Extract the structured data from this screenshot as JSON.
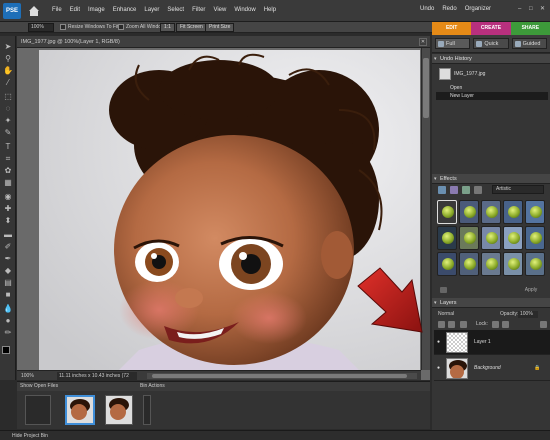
{
  "app": {
    "logo": "PSE",
    "title": "IMG_1977.jpg @ 100%(Layer 1, RGB/8)"
  },
  "menu": [
    "File",
    "Edit",
    "Image",
    "Enhance",
    "Layer",
    "Select",
    "Filter",
    "View",
    "Window",
    "Help"
  ],
  "top_right": {
    "undo": "Undo",
    "redo": "Redo",
    "organizer": "Organizer"
  },
  "options_bar": {
    "zoom": "100%",
    "resize_windows": "Resize Windows To Fit",
    "zoom_all": "Zoom All Windows",
    "one_to_one": "1:1",
    "fit_screen": "Fit Screen",
    "print_size": "Print Size"
  },
  "modes": {
    "edit": "EDIT",
    "create": "CREATE",
    "share": "SHARE"
  },
  "subtabs": {
    "full": "Full",
    "quick": "Quick",
    "guided": "Guided"
  },
  "doc_status": {
    "zoom": "100%",
    "dimensions": "11.11 inches x 10.43 inches (72 ppi)"
  },
  "undo_history": {
    "title": "Undo History",
    "snapshot": "IMG_1977.jpg",
    "steps": [
      "Open",
      "New Layer"
    ]
  },
  "effects": {
    "title": "Effects",
    "category": "Artistic",
    "apply": "Apply"
  },
  "layers": {
    "title": "Layers",
    "blend": "Normal",
    "opacity_label": "Opacity:",
    "opacity": "100%",
    "lock": "Lock:",
    "items": [
      {
        "name": "Layer 1"
      },
      {
        "name": "Background"
      }
    ]
  },
  "project_bin": {
    "show": "Show Open Files",
    "actions": "Bin Actions",
    "hide": "Hide Project Bin"
  }
}
